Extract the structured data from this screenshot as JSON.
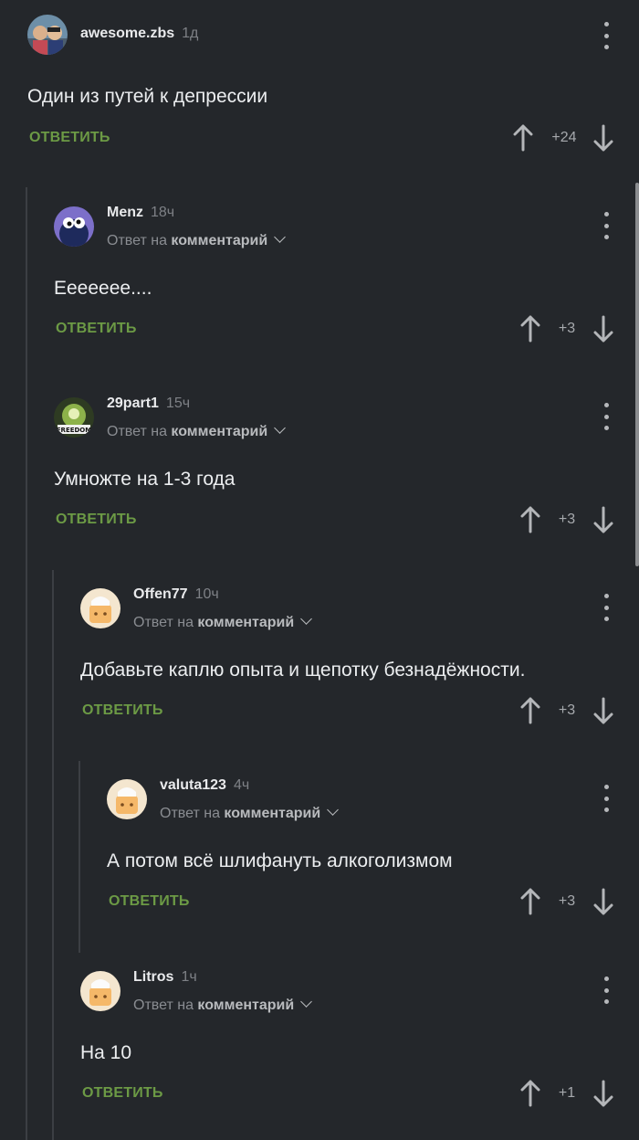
{
  "reply_label": "ОТВЕТИТЬ",
  "reply_to_prefix": "Ответ на",
  "reply_to_target": "комментарий",
  "comments": [
    {
      "username": "awesome.zbs",
      "time": "1д",
      "text": "Один из путей к депрессии",
      "score": "+24",
      "avatar": "photo-avatar",
      "is_reply": false
    },
    {
      "username": "Menz",
      "time": "18ч",
      "text": "Ееееееe....",
      "score": "+3",
      "avatar": "cookie-monster-avatar",
      "is_reply": true
    },
    {
      "username": "29part1",
      "time": "15ч",
      "text": "Умножте на 1-3 года",
      "score": "+3",
      "avatar": "freedom-avatar",
      "is_reply": true
    },
    {
      "username": "Offen77",
      "time": "10ч",
      "text": "Добавьте каплю опыта и щепотку безнадёжности.",
      "score": "+3",
      "avatar": "default-chef-avatar",
      "is_reply": true
    },
    {
      "username": "valuta123",
      "time": "4ч",
      "text": "А потом всё шлифануть алкоголизмом",
      "score": "+3",
      "avatar": "default-chef-avatar",
      "is_reply": true
    },
    {
      "username": "Litros",
      "time": "1ч",
      "text": "На 10",
      "score": "+1",
      "avatar": "default-chef-avatar",
      "is_reply": true
    }
  ],
  "colors": {
    "background": "#24272b",
    "reply_green": "#6c9a45",
    "thread_line": "#3c3f44",
    "text": "#eceef0",
    "muted": "#8a8d92"
  }
}
